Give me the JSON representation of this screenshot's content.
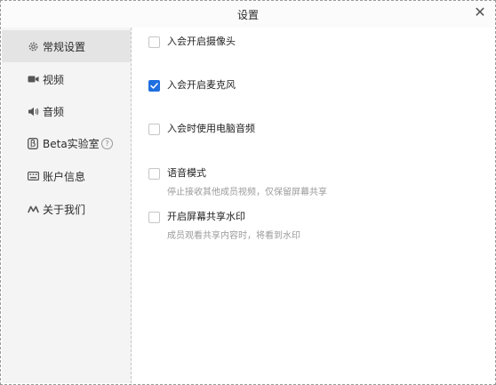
{
  "window": {
    "title": "设置",
    "close_glyph": "✕"
  },
  "sidebar": {
    "items": [
      {
        "label": "常规设置",
        "icon": "gear-icon",
        "active": true
      },
      {
        "label": "视频",
        "icon": "camera-icon",
        "active": false
      },
      {
        "label": "音频",
        "icon": "speaker-icon",
        "active": false
      },
      {
        "label": "Beta实验室",
        "icon": "beta-icon",
        "active": false,
        "help": "?"
      },
      {
        "label": "账户信息",
        "icon": "keyboard-icon",
        "active": false
      },
      {
        "label": "关于我们",
        "icon": "logo-icon",
        "active": false
      }
    ]
  },
  "options": [
    {
      "label": "入会开启摄像头",
      "checked": false,
      "desc": ""
    },
    {
      "label": "入会开启麦克风",
      "checked": true,
      "desc": ""
    },
    {
      "label": "入会时使用电脑音频",
      "checked": false,
      "desc": ""
    },
    {
      "label": "语音模式",
      "checked": false,
      "desc": "停止接收其他成员视频，仅保留屏幕共享"
    },
    {
      "label": "开启屏幕共享水印",
      "checked": false,
      "desc": "成员观看共享内容时，将看到水印"
    }
  ],
  "colors": {
    "accent": "#1e6fe0",
    "sidebar_bg": "#f4f4f4",
    "active_bg": "#e4e4e4"
  }
}
